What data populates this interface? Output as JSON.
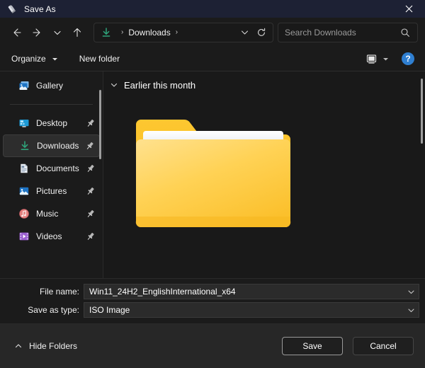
{
  "window": {
    "title": "Save As",
    "app_icon": "rufus-icon",
    "close_label": "Close",
    "titlebar_color": "#1d2134"
  },
  "nav": {
    "back_icon": "arrow-left-icon",
    "forward_icon": "arrow-right-icon",
    "recent_icon": "chevron-down-icon",
    "up_icon": "arrow-up-icon",
    "address": {
      "location_icon": "downloads-arrow-icon",
      "crumb": "Downloads",
      "separator": "›",
      "leading_separator": "›",
      "dropdown_icon": "chevron-down-icon",
      "refresh_icon": "refresh-icon"
    },
    "search": {
      "placeholder": "Search Downloads",
      "value": "",
      "icon": "search-icon"
    }
  },
  "commandbar": {
    "organize": "Organize",
    "organize_caret": "chevron-down-icon",
    "new_folder": "New folder",
    "view_icon": "view-layout-icon",
    "view_caret": "chevron-down-icon",
    "help_label": "?",
    "help_icon": "help-icon"
  },
  "sidebar": {
    "items": [
      {
        "label": "Gallery",
        "icon": "gallery-icon",
        "pinned": false,
        "selected": false
      },
      {
        "label": "Desktop",
        "icon": "desktop-icon",
        "pinned": true,
        "selected": false
      },
      {
        "label": "Downloads",
        "icon": "downloads-icon",
        "pinned": true,
        "selected": true
      },
      {
        "label": "Documents",
        "icon": "documents-icon",
        "pinned": true,
        "selected": false
      },
      {
        "label": "Pictures",
        "icon": "pictures-icon",
        "pinned": true,
        "selected": false
      },
      {
        "label": "Music",
        "icon": "music-icon",
        "pinned": true,
        "selected": false
      },
      {
        "label": "Videos",
        "icon": "videos-icon",
        "pinned": true,
        "selected": false
      }
    ],
    "pin_icon": "pin-icon"
  },
  "content": {
    "group": {
      "expand_icon": "chevron-down-icon",
      "title": "Earlier this month"
    },
    "items": [
      {
        "icon": "folder-icon",
        "label": ""
      }
    ]
  },
  "form": {
    "file_name": {
      "label": "File name:",
      "value": "Win11_24H2_EnglishInternational_x64",
      "dropdown_icon": "chevron-down-icon"
    },
    "save_as_type": {
      "label": "Save as type:",
      "value": "ISO Image",
      "dropdown_icon": "chevron-down-icon"
    }
  },
  "footer": {
    "hide_folders": {
      "label": "Hide Folders",
      "icon": "chevron-up-icon"
    },
    "save": "Save",
    "cancel": "Cancel"
  },
  "colors": {
    "titlebar": "#1d2134",
    "accent_blue": "#2f7fd1",
    "downloads_green": "#2fa37a",
    "folder_yellow": "#fcc93c",
    "music_pink": "#e4817f",
    "videos_purple": "#9b5fd0"
  }
}
